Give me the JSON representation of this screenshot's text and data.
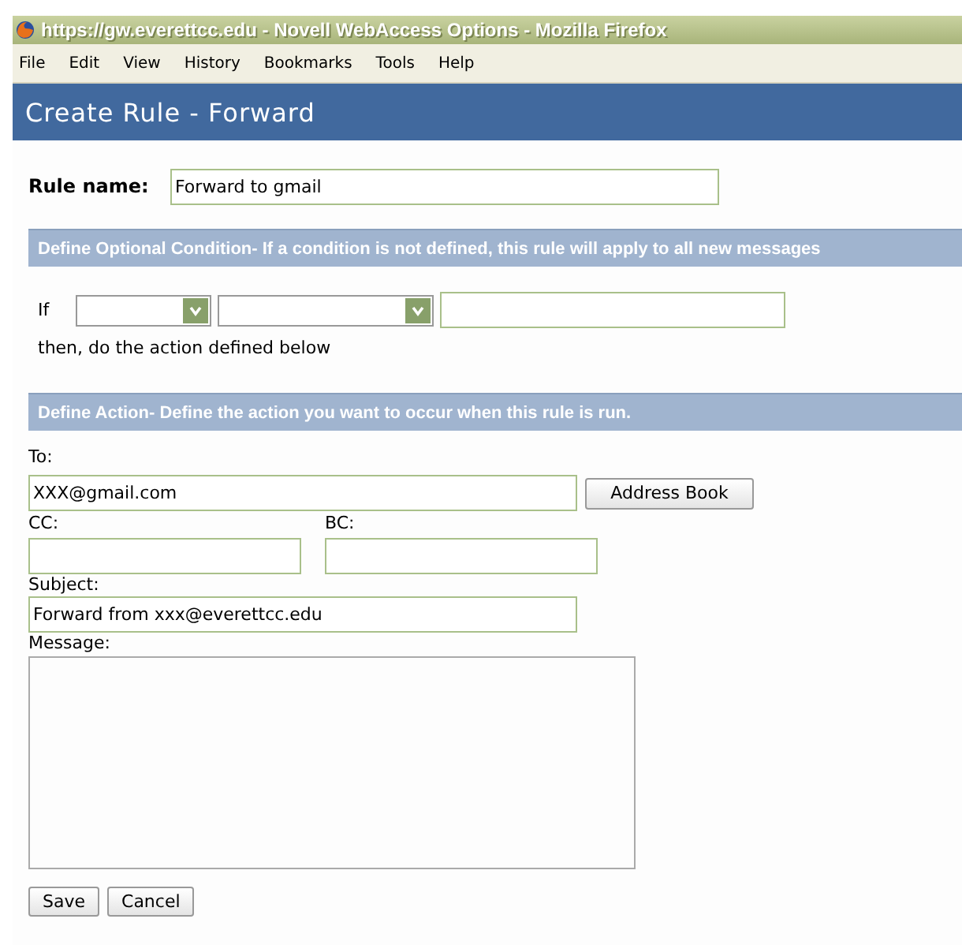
{
  "window": {
    "title": "https://gw.everettcc.edu - Novell WebAccess Options - Mozilla Firefox"
  },
  "menu": [
    "File",
    "Edit",
    "View",
    "History",
    "Bookmarks",
    "Tools",
    "Help"
  ],
  "page_title": "Create Rule - Forward",
  "rule_name": {
    "label": "Rule name:",
    "value": "Forward to gmail"
  },
  "condition": {
    "heading": "Define Optional Condition- If a condition is not defined, this rule will apply to all new messages",
    "if_label": "If",
    "then_text": "then, do the action defined below"
  },
  "action": {
    "heading": "Define Action- Define the action you want to occur when this rule is run.",
    "to": {
      "label": "To:",
      "value": "XXX@gmail.com"
    },
    "address_book": "Address Book",
    "cc": {
      "label": "CC:"
    },
    "bc": {
      "label": "BC:"
    },
    "subject": {
      "label": "Subject:",
      "value": "Forward from xxx@everettcc.edu"
    },
    "message": {
      "label": "Message:"
    }
  },
  "buttons": [
    "Save",
    "Cancel"
  ]
}
